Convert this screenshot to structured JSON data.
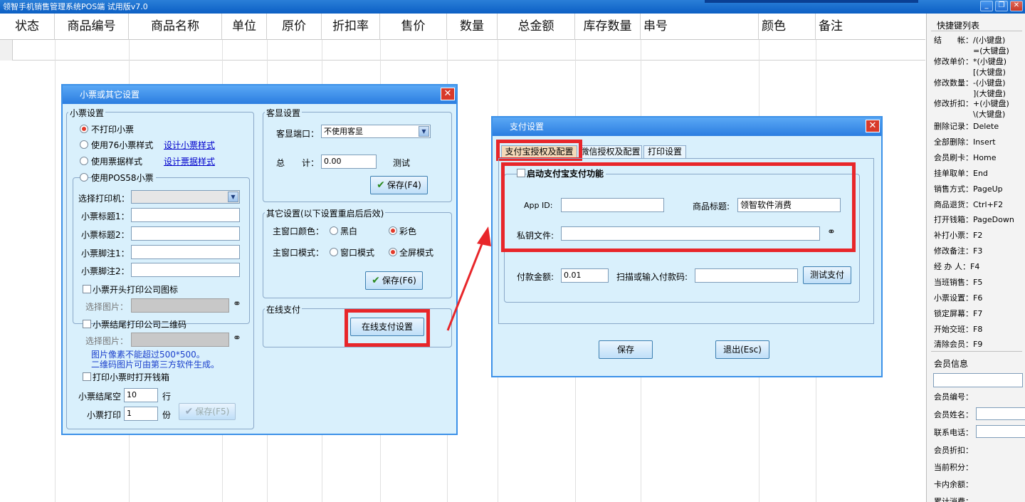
{
  "window": {
    "title": "领智手机销售管理系统POS端 试用版v7.0",
    "buttons": [
      "_",
      "❐",
      "✕"
    ]
  },
  "grid": {
    "columns": [
      "状态",
      "商品编号",
      "商品名称",
      "单位",
      "原价",
      "折扣率",
      "售价",
      "数量",
      "总金额",
      "库存数量",
      "串号",
      "颜色",
      "备注"
    ]
  },
  "shortcuts": {
    "title": "快捷键列表",
    "lines": [
      "结　　帐：/(小键盘)",
      "　　　　　=(大键盘)",
      "修改单价：*(小键盘)",
      "　　　　　[(大键盘)",
      "修改数量：-(小键盘)",
      "　　　　　](大键盘)",
      "修改折扣：+(小键盘)",
      "　　　　　\\(大键盘)",
      "删除记录：Delete",
      "全部删除：Insert",
      "会员刷卡：Home",
      "挂单取单：End",
      "销售方式：PageUp",
      "商品退货：Ctrl+F2",
      "打开钱箱：PageDown",
      "补打小票：F2",
      "修改备注：F3",
      "经 办 人：F4",
      "当班销售：F5",
      "小票设置：F6",
      "锁定屏幕：F7",
      "开始交班：F8",
      "清除会员：F9"
    ]
  },
  "member": {
    "title": "会员信息",
    "fields": [
      "会员编号：",
      "会员姓名：",
      "联系电话：",
      "会员折扣：",
      "当前积分：",
      "卡内余额：",
      "累计消费："
    ]
  },
  "receipt_dialog": {
    "title": "小票或其它设置",
    "close": "✕",
    "receipt_group": "小票设置",
    "radio_options": [
      "不打印小票",
      "使用76小票样式",
      "使用票据样式"
    ],
    "radio_selected": 0,
    "link_76": "设计小票样式",
    "link_bill": "设计票据样式",
    "pos58_label": "使用POS58小票",
    "printer_label": "选择打印机：",
    "title1_label": "小票标题1：",
    "title2_label": "小票标题2：",
    "foot1_label": "小票脚注1：",
    "foot2_label": "小票脚注2：",
    "print_logo_label": "小票开头打印公司图标",
    "choose_image_label": "选择图片：",
    "print_qr_label": "小票结尾打印公司二维码",
    "choose_image_label2": "选择图片：",
    "hint_line1": "图片像素不能超过500*500。",
    "hint_line2": "二维码图片可由第三方软件生成。",
    "open_drawer_label": "打印小票时打开钱箱",
    "tail_blank_label": "小票结尾空",
    "tail_blank_value": "10",
    "tail_blank_unit": "行",
    "print_copies_label": "小票打印",
    "print_copies_value": "1",
    "print_copies_unit": "份",
    "save_f5": "保存(F5)",
    "customer_display_group": "客显设置",
    "port_label": "客显端口：",
    "port_value": "不使用客显",
    "total_label": "总　　计：",
    "total_value": "0.00",
    "test_label": "测试",
    "save_f4": "保存(F4)",
    "other_group": "其它设置(以下设置重启后后效)",
    "main_color_label": "主窗口颜色：",
    "color_options": [
      "黑白",
      "彩色"
    ],
    "color_selected": 1,
    "main_mode_label": "主窗口模式：",
    "mode_options": [
      "窗口模式",
      "全屏模式"
    ],
    "mode_selected": 1,
    "save_f6": "保存(F6)",
    "online_pay_group": "在线支付",
    "online_pay_button": "在线支付设置"
  },
  "pay_dialog": {
    "title": "支付设置",
    "close": "✕",
    "tabs": [
      "支付宝授权及配置",
      "微信授权及配置",
      "打印设置"
    ],
    "active_tab": 0,
    "enable_label": "启动支付宝支付功能",
    "appid_label": "App ID:",
    "appid_value": "",
    "product_title_label": "商品标题:",
    "product_title_value": "领智软件消费",
    "key_file_label": "私钥文件:",
    "key_file_value": "",
    "amount_label": "付款金额:",
    "amount_value": "0.01",
    "scan_label": "扫描或输入付款码:",
    "scan_value": "",
    "test_pay_button": "测试支付",
    "save_button": "保存",
    "exit_button": "退出(Esc)"
  },
  "colors": {
    "annotation_red": "#e8262a",
    "dialog_bg": "#d9f0fc",
    "dialog_title": "#2b7de0"
  }
}
